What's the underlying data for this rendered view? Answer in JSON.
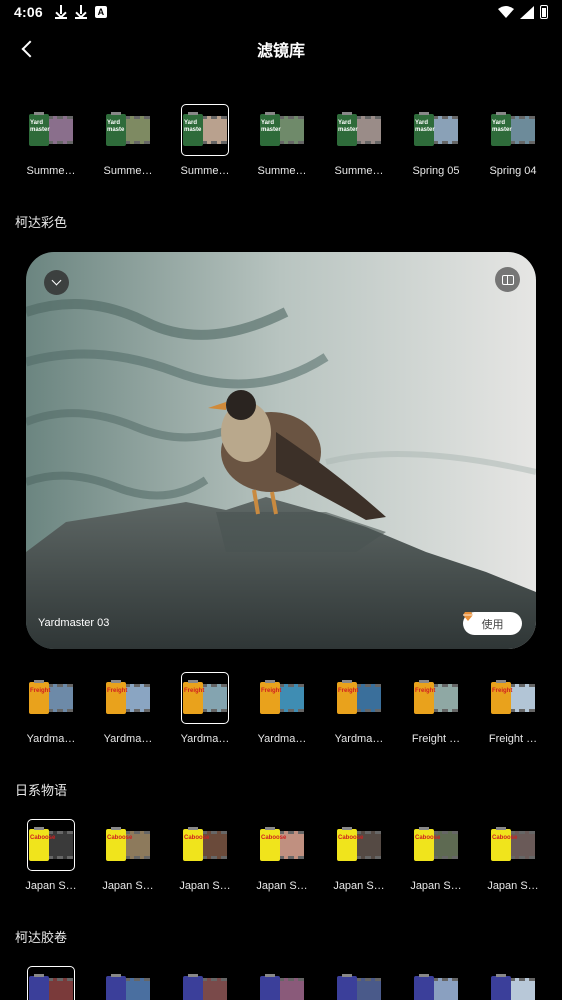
{
  "status_bar": {
    "time": "4:06"
  },
  "header": {
    "title": "滤镜库"
  },
  "row1": [
    {
      "name": "Summe…",
      "label": "Yard\nmaster",
      "canister": "#2e6b3a",
      "photo": "#8a6f8c",
      "selected": false
    },
    {
      "name": "Summe…",
      "label": "Yard\nmaste",
      "canister": "#2e6b3a",
      "photo": "#7e8a62",
      "selected": false
    },
    {
      "name": "Summe…",
      "label": "Yard\nmaste",
      "canister": "#2e6b3a",
      "photo": "#b9a18e",
      "selected": true
    },
    {
      "name": "Summe…",
      "label": "Yard\nmaster",
      "canister": "#2e6b3a",
      "photo": "#6f8a6a",
      "selected": false
    },
    {
      "name": "Summe…",
      "label": "Yard\nmaster",
      "canister": "#2e6b3a",
      "photo": "#9a8c88",
      "selected": false
    },
    {
      "name": "Spring 05",
      "label": "Yard\nmaster",
      "canister": "#2e6b3a",
      "photo": "#8aa1b7",
      "selected": false
    },
    {
      "name": "Spring 04",
      "label": "Yard\nmaster",
      "canister": "#2e6b3a",
      "photo": "#6d8b9a",
      "selected": false
    }
  ],
  "section_kodak_color": "柯达彩色",
  "preview": {
    "name": "Yardmaster 03",
    "use_label": "使用"
  },
  "row2": [
    {
      "name": "Yardma…",
      "label": "Freight",
      "canister": "#e9a21c",
      "photo": "#6d8aa8",
      "selected": false
    },
    {
      "name": "Yardma…",
      "label": "Freight",
      "canister": "#e9a21c",
      "photo": "#8aa5c2",
      "selected": false
    },
    {
      "name": "Yardma…",
      "label": "Freight",
      "canister": "#e9a21c",
      "photo": "#84a4b0",
      "selected": true
    },
    {
      "name": "Yardma…",
      "label": "Freight",
      "canister": "#e9a21c",
      "photo": "#3f8db3",
      "selected": false
    },
    {
      "name": "Yardma…",
      "label": "Freight",
      "canister": "#e9a21c",
      "photo": "#3a6f9b",
      "selected": false
    },
    {
      "name": "Freight …",
      "label": "Freight",
      "canister": "#e9a21c",
      "photo": "#8fa8a4",
      "selected": false
    },
    {
      "name": "Freight …",
      "label": "Freight",
      "canister": "#e9a21c",
      "photo": "#b2c5d6",
      "selected": false
    }
  ],
  "section_japan": "日系物语",
  "row3": [
    {
      "name": "Japan S…",
      "label": "Caboose",
      "canister": "#f0e41c",
      "photo": "#3a3a3a",
      "selected": true
    },
    {
      "name": "Japan S…",
      "label": "Caboose",
      "canister": "#f0e41c",
      "photo": "#8d7a5c",
      "selected": false
    },
    {
      "name": "Japan S…",
      "label": "Caboose",
      "canister": "#f0e41c",
      "photo": "#6a4a3a",
      "selected": false
    },
    {
      "name": "Japan S…",
      "label": "Caboose",
      "canister": "#f0e41c",
      "photo": "#c09080",
      "selected": false
    },
    {
      "name": "Japan S…",
      "label": "Caboose",
      "canister": "#f0e41c",
      "photo": "#554a44",
      "selected": false
    },
    {
      "name": "Japan S…",
      "label": "Caboose",
      "canister": "#f0e41c",
      "photo": "#5e6a52",
      "selected": false
    },
    {
      "name": "Japan S…",
      "label": "Caboose",
      "canister": "#f0e41c",
      "photo": "#6a5a58",
      "selected": false
    }
  ],
  "section_kodak_film": "柯达胶卷",
  "row4": [
    {
      "canister": "#3b3f9a",
      "photo": "#7a3a3a",
      "selected": true
    },
    {
      "canister": "#3b3f9a",
      "photo": "#4a6fa0",
      "selected": false
    },
    {
      "canister": "#3b3f9a",
      "photo": "#7a4a4a",
      "selected": false
    },
    {
      "canister": "#3b3f9a",
      "photo": "#8a5a7a",
      "selected": false
    },
    {
      "canister": "#3b3f9a",
      "photo": "#4a5a8a",
      "selected": false
    },
    {
      "canister": "#3b3f9a",
      "photo": "#8aa0c0",
      "selected": false
    },
    {
      "canister": "#3b3f9a",
      "photo": "#b8c8d8",
      "selected": false
    }
  ]
}
